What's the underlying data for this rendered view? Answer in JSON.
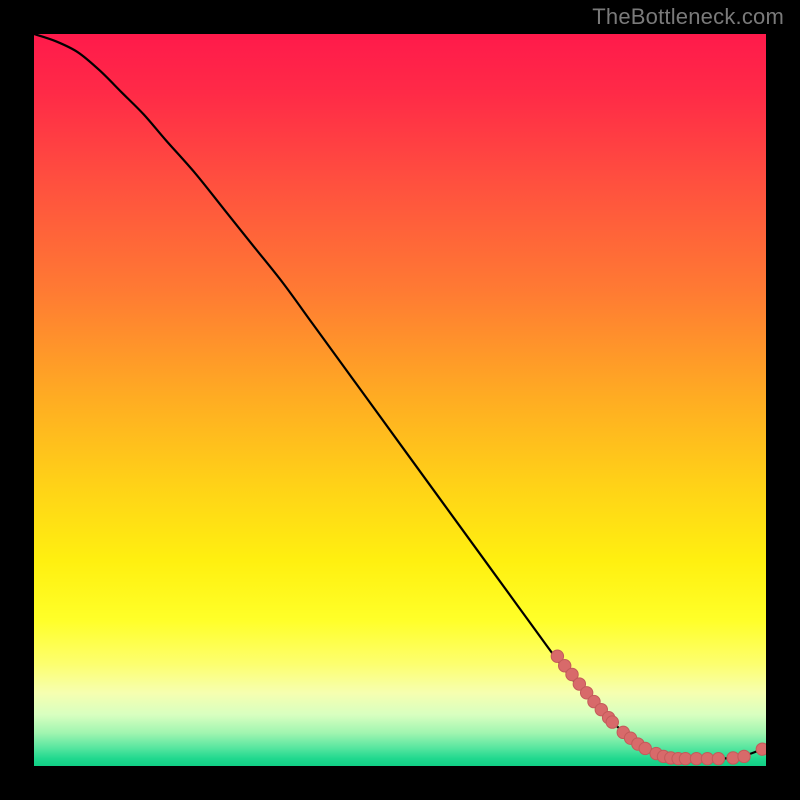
{
  "attribution": "TheBottleneck.com",
  "colors": {
    "gradient_stops": [
      {
        "offset": 0.0,
        "color": "#ff1a4b"
      },
      {
        "offset": 0.08,
        "color": "#ff2a47"
      },
      {
        "offset": 0.2,
        "color": "#ff4f3f"
      },
      {
        "offset": 0.35,
        "color": "#ff7a33"
      },
      {
        "offset": 0.5,
        "color": "#ffad22"
      },
      {
        "offset": 0.62,
        "color": "#ffd317"
      },
      {
        "offset": 0.72,
        "color": "#fff010"
      },
      {
        "offset": 0.8,
        "color": "#ffff28"
      },
      {
        "offset": 0.86,
        "color": "#fdff6e"
      },
      {
        "offset": 0.9,
        "color": "#f6ffb0"
      },
      {
        "offset": 0.93,
        "color": "#d8ffc0"
      },
      {
        "offset": 0.955,
        "color": "#a0f5b0"
      },
      {
        "offset": 0.975,
        "color": "#58e6a0"
      },
      {
        "offset": 0.99,
        "color": "#20d88e"
      },
      {
        "offset": 1.0,
        "color": "#10cf85"
      }
    ],
    "line": "#000000",
    "dot_fill": "#d86a6a",
    "dot_stroke": "#c35a5a"
  },
  "chart_data": {
    "type": "line",
    "title": "",
    "xlabel": "",
    "ylabel": "",
    "xlim": [
      0,
      100
    ],
    "ylim": [
      0,
      100
    ],
    "grid": false,
    "legend": false,
    "series": [
      {
        "name": "curve",
        "x": [
          0,
          3,
          6,
          9,
          12,
          15,
          18,
          22,
          26,
          30,
          34,
          38,
          42,
          46,
          50,
          54,
          58,
          62,
          66,
          70,
          73,
          76,
          79,
          82,
          85,
          88,
          91,
          94,
          97,
          100
        ],
        "y": [
          100,
          99,
          97.5,
          95,
          92,
          89,
          85.5,
          81,
          76,
          71,
          66,
          60.5,
          55,
          49.5,
          44,
          38.5,
          33,
          27.5,
          22,
          16.5,
          12.5,
          9,
          6,
          3.5,
          2,
          1.2,
          1,
          1,
          1.4,
          2.5
        ]
      }
    ],
    "scatter": {
      "name": "highlight-dots",
      "points": [
        {
          "x": 71.5,
          "y": 15.0
        },
        {
          "x": 72.5,
          "y": 13.7
        },
        {
          "x": 73.5,
          "y": 12.5
        },
        {
          "x": 74.5,
          "y": 11.2
        },
        {
          "x": 75.5,
          "y": 10.0
        },
        {
          "x": 76.5,
          "y": 8.8
        },
        {
          "x": 77.5,
          "y": 7.7
        },
        {
          "x": 78.5,
          "y": 6.6
        },
        {
          "x": 79.0,
          "y": 6.0
        },
        {
          "x": 80.5,
          "y": 4.6
        },
        {
          "x": 81.5,
          "y": 3.8
        },
        {
          "x": 82.5,
          "y": 3.0
        },
        {
          "x": 83.5,
          "y": 2.4
        },
        {
          "x": 85.0,
          "y": 1.7
        },
        {
          "x": 86.0,
          "y": 1.3
        },
        {
          "x": 87.0,
          "y": 1.1
        },
        {
          "x": 88.0,
          "y": 1.0
        },
        {
          "x": 89.0,
          "y": 1.0
        },
        {
          "x": 90.5,
          "y": 1.0
        },
        {
          "x": 92.0,
          "y": 1.0
        },
        {
          "x": 93.5,
          "y": 1.0
        },
        {
          "x": 95.5,
          "y": 1.1
        },
        {
          "x": 97.0,
          "y": 1.3
        },
        {
          "x": 99.5,
          "y": 2.3
        }
      ]
    }
  }
}
